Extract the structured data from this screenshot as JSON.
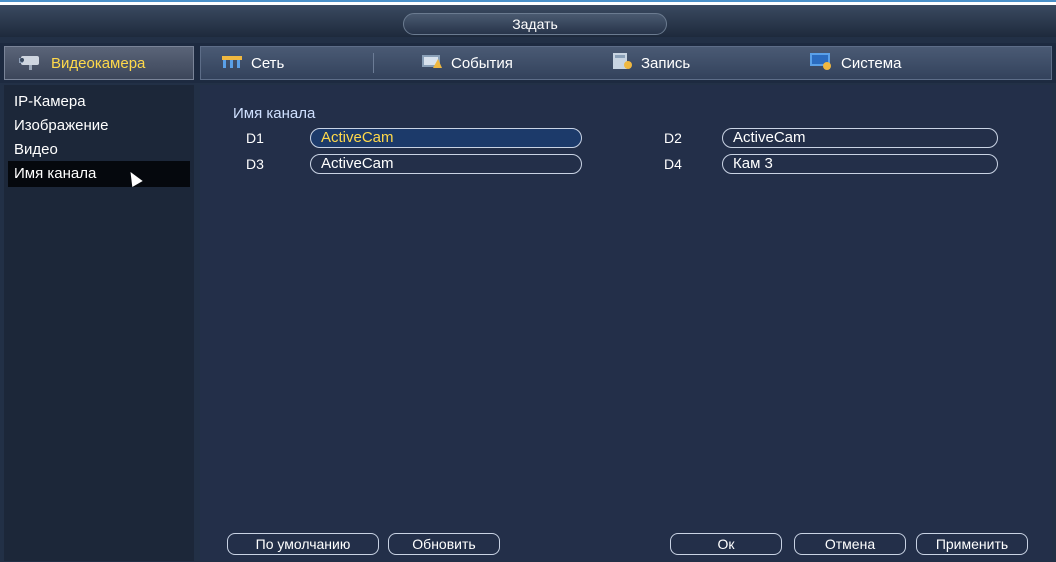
{
  "window": {
    "title": "Задать"
  },
  "tabs": {
    "active": {
      "label": "Видеокамера",
      "icon": "camera-icon"
    },
    "items": [
      {
        "label": "Сеть",
        "icon": "network-icon"
      },
      {
        "label": "События",
        "icon": "events-icon"
      },
      {
        "label": "Запись",
        "icon": "record-icon"
      },
      {
        "label": "Система",
        "icon": "system-icon"
      }
    ]
  },
  "sidebar": {
    "items": [
      {
        "label": "IP-Камера"
      },
      {
        "label": "Изображение"
      },
      {
        "label": "Видео"
      },
      {
        "label": "Имя канала",
        "selected": true
      }
    ]
  },
  "main": {
    "section_title": "Имя канала",
    "channels": [
      {
        "label": "D1",
        "value": "ActiveCam",
        "focused": true
      },
      {
        "label": "D2",
        "value": "ActiveCam"
      },
      {
        "label": "D3",
        "value": "ActiveCam"
      },
      {
        "label": "D4",
        "value": "Кам 3"
      }
    ]
  },
  "buttons": {
    "default": "По умолчанию",
    "refresh": "Обновить",
    "ok": "Ок",
    "cancel": "Отмена",
    "apply": "Применить"
  },
  "colors": {
    "accent": "#ffd94a",
    "background": "#232f49",
    "sidebar": "#1c2739"
  }
}
